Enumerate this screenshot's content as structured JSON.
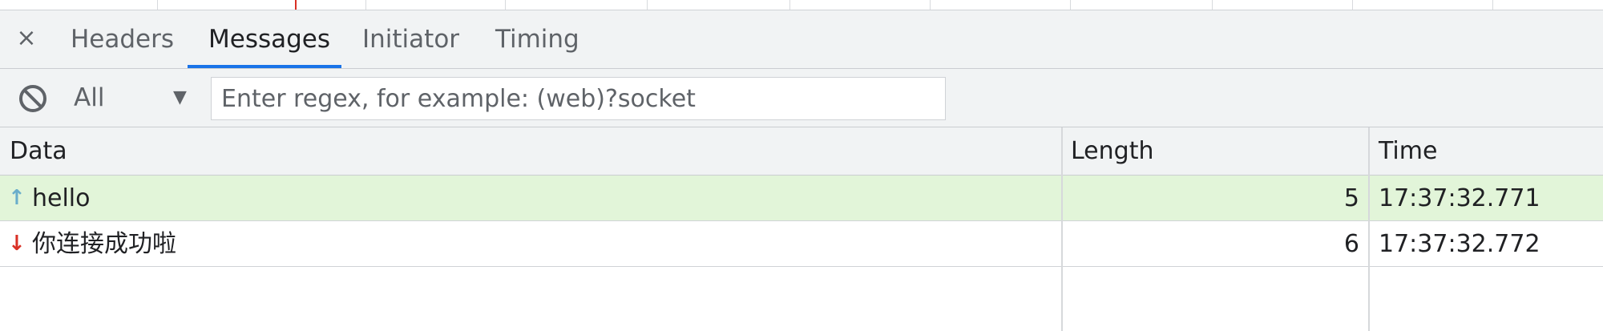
{
  "tabs": {
    "close_glyph": "×",
    "items": [
      {
        "label": "Headers",
        "active": false
      },
      {
        "label": "Messages",
        "active": true
      },
      {
        "label": "Initiator",
        "active": false
      },
      {
        "label": "Timing",
        "active": false
      }
    ]
  },
  "filter": {
    "clear_icon": "block-icon",
    "type_selected": "All",
    "type_arrow": "▼",
    "search_placeholder": "Enter regex, for example: (web)?socket",
    "search_value": ""
  },
  "table": {
    "columns": [
      "Data",
      "Length",
      "Time"
    ],
    "rows": [
      {
        "direction": "sent",
        "arrow": "↑",
        "data": "hello",
        "length": "5",
        "time": "17:37:32.771"
      },
      {
        "direction": "received",
        "arrow": "↓",
        "data": "你连接成功啦",
        "length": "6",
        "time": "17:37:32.772"
      }
    ]
  },
  "colors": {
    "sent_row_bg": "#e2f5d9",
    "sent_arrow": "#6aaecb",
    "received_arrow": "#d93025",
    "active_tab_underline": "#1a73e8"
  }
}
